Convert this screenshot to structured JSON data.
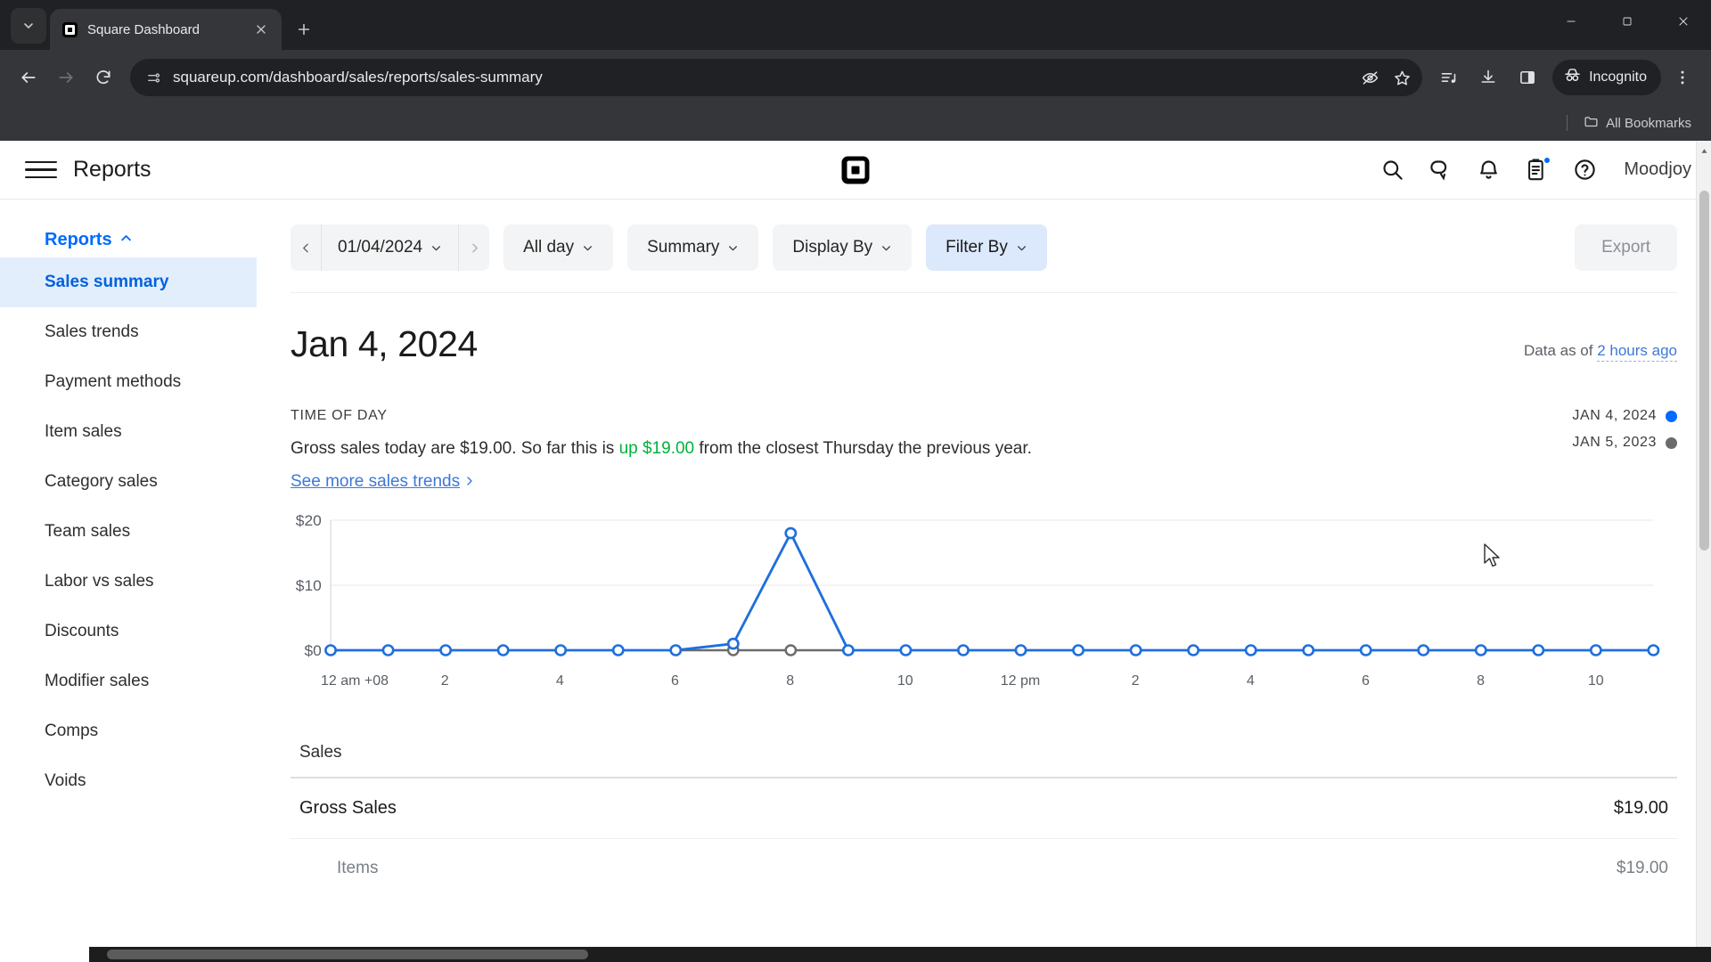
{
  "browser": {
    "tab": {
      "title": "Square Dashboard",
      "favicon": "square-logo-icon"
    },
    "new_tab_label": "+",
    "url": "squareup.com/dashboard/sales/reports/sales-summary",
    "incognito_label": "Incognito",
    "bookmarks_label": "All Bookmarks",
    "toolbar_icons": [
      "eye-slash-icon",
      "star-icon",
      "media-control-icon",
      "download-icon",
      "side-panel-icon",
      "incognito-icon",
      "three-dot-menu-icon"
    ],
    "window_controls": [
      "minimize",
      "maximize",
      "close"
    ]
  },
  "app": {
    "title": "Reports",
    "logo": "square-logo-icon",
    "user": "Moodjoy",
    "header_icons": [
      "search-icon",
      "messages-icon",
      "bell-icon",
      "clipboard-icon",
      "help-icon"
    ]
  },
  "sidebar": {
    "group_label": "Reports",
    "items": [
      {
        "label": "Sales summary",
        "active": true
      },
      {
        "label": "Sales trends",
        "active": false
      },
      {
        "label": "Payment methods",
        "active": false
      },
      {
        "label": "Item sales",
        "active": false
      },
      {
        "label": "Category sales",
        "active": false
      },
      {
        "label": "Team sales",
        "active": false
      },
      {
        "label": "Labor vs sales",
        "active": false
      },
      {
        "label": "Discounts",
        "active": false
      },
      {
        "label": "Modifier sales",
        "active": false
      },
      {
        "label": "Comps",
        "active": false
      },
      {
        "label": "Voids",
        "active": false
      }
    ]
  },
  "toolbar": {
    "date_value": "01/04/2024",
    "all_day": "All day",
    "summary": "Summary",
    "display_by": "Display By",
    "filter_by": "Filter By",
    "export": "Export"
  },
  "main": {
    "page_title": "Jan 4, 2024",
    "data_as_of_prefix": "Data as of ",
    "data_as_of_link": "2 hours ago",
    "section_label": "TIME OF DAY",
    "summary_pre": "Gross sales today are $19.00. So far this is ",
    "summary_highlight": "up $19.00",
    "summary_post": " from the closest Thursday the previous year.",
    "trend_link": "See more sales trends"
  },
  "table": {
    "header": "Sales",
    "rows": [
      {
        "label": "Gross Sales",
        "value": "$19.00",
        "sub": false
      },
      {
        "label": "Items",
        "value": "$19.00",
        "sub": true
      }
    ]
  },
  "colors": {
    "accent_blue": "#006aff",
    "link_blue": "#3d78d8",
    "series_current": "#1f6fdd",
    "series_previous": "#6b6b6b",
    "positive_green": "#00b23d",
    "active_pill": "#dce8fb"
  },
  "chart_data": {
    "type": "line",
    "title": "TIME OF DAY",
    "xlabel": "",
    "ylabel": "",
    "ylim": [
      0,
      20
    ],
    "yticks": [
      0,
      10,
      20
    ],
    "ytick_labels": [
      "$0",
      "$10",
      "$20"
    ],
    "grid": true,
    "legend_position": "top-right",
    "x": [
      0,
      1,
      2,
      3,
      4,
      5,
      6,
      7,
      8,
      9,
      10,
      11,
      12,
      13,
      14,
      15,
      16,
      17,
      18,
      19,
      20,
      21,
      22,
      23
    ],
    "xtick_labels": [
      {
        "x": 0,
        "label": "12 am +08"
      },
      {
        "x": 2,
        "label": "2"
      },
      {
        "x": 4,
        "label": "4"
      },
      {
        "x": 6,
        "label": "6"
      },
      {
        "x": 8,
        "label": "8"
      },
      {
        "x": 10,
        "label": "10"
      },
      {
        "x": 12,
        "label": "12 pm"
      },
      {
        "x": 14,
        "label": "2"
      },
      {
        "x": 16,
        "label": "4"
      },
      {
        "x": 18,
        "label": "6"
      },
      {
        "x": 20,
        "label": "8"
      },
      {
        "x": 22,
        "label": "10"
      }
    ],
    "series": [
      {
        "name": "JAN 4, 2024",
        "color": "#1f6fdd",
        "markers": true,
        "values": [
          0,
          0,
          0,
          0,
          0,
          0,
          0,
          1,
          18,
          0,
          0,
          0,
          0,
          0,
          0,
          0,
          0,
          0,
          0,
          0,
          0,
          0,
          0,
          0
        ]
      },
      {
        "name": "JAN 5, 2023",
        "color": "#6b6b6b",
        "markers": true,
        "marker_x": [
          7,
          8
        ],
        "values": [
          null,
          null,
          null,
          null,
          null,
          null,
          0,
          0,
          0,
          0,
          null,
          null,
          null,
          null,
          null,
          null,
          null,
          null,
          null,
          null,
          null,
          null,
          null,
          null
        ]
      }
    ]
  }
}
